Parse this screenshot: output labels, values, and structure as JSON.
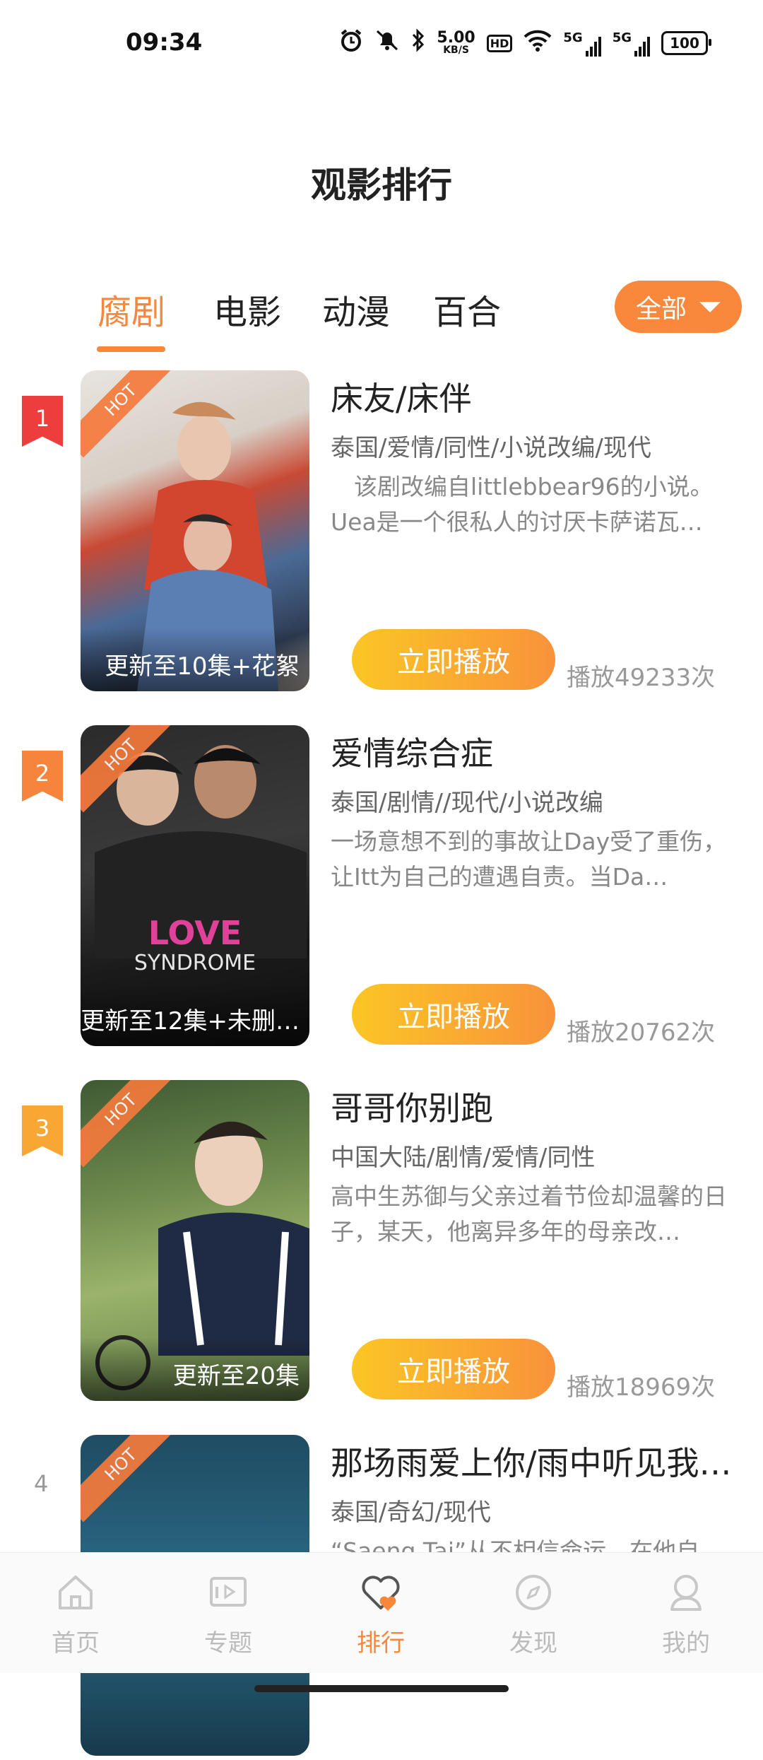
{
  "status_bar": {
    "time": "09:34",
    "speed_value": "5.00",
    "speed_unit": "KB/S",
    "hd": "HD",
    "network_1": "5G",
    "network_2": "5G",
    "battery": "100"
  },
  "page": {
    "title": "观影排行"
  },
  "tabs": [
    {
      "label": "腐剧",
      "active": true
    },
    {
      "label": "电影"
    },
    {
      "label": "动漫"
    },
    {
      "label": "百合"
    }
  ],
  "filter": {
    "label": "全部"
  },
  "items": [
    {
      "rank": "1",
      "hot": "HOT",
      "title": "床友/床伴",
      "tags": "泰国/爱情/同性/小说改编/现代",
      "desc": "　该剧改编自littlebbear96的小说。Uea是一个很私人的讨厌卡萨诺瓦…",
      "poster_caption": "更新至10集+花絮",
      "play_label": "立即播放",
      "play_count": "播放49233次",
      "badge_color": "#ee3d3d"
    },
    {
      "rank": "2",
      "hot": "HOT",
      "title": "爱情综合症",
      "tags": "泰国/剧情//现代/小说改编",
      "desc": "一场意想不到的事故让Day受了重伤，让Itt为自己的遭遇自责。当Da…",
      "poster_caption": "更新至12集+未删…",
      "play_label": "立即播放",
      "play_count": "播放20762次",
      "badge_color": "#f6843c"
    },
    {
      "rank": "3",
      "hot": "HOT",
      "title": "哥哥你别跑",
      "tags": "中国大陆/剧情/爱情/同性",
      "desc": "高中生苏御与父亲过着节俭却温馨的日子，某天，他离异多年的母亲改…",
      "poster_caption": "更新至20集",
      "play_label": "立即播放",
      "play_count": "播放18969次",
      "badge_color": "#f8a634"
    },
    {
      "rank": "4",
      "hot": "HOT",
      "title": "那场雨爱上你/雨中听见我…",
      "tags": "泰国/奇幻/现代",
      "desc": "“Saeng Tai”从不相信命运，在他自己…"
    }
  ],
  "bottom_nav": [
    {
      "label": "首页",
      "icon": "home-icon"
    },
    {
      "label": "专题",
      "icon": "topic-icon"
    },
    {
      "label": "排行",
      "icon": "rank-heart-icon",
      "active": true
    },
    {
      "label": "发现",
      "icon": "compass-icon"
    },
    {
      "label": "我的",
      "icon": "profile-icon"
    }
  ],
  "colors": {
    "accent": "#f6873b",
    "play_start": "#fbc625",
    "play_end": "#f9923b"
  }
}
